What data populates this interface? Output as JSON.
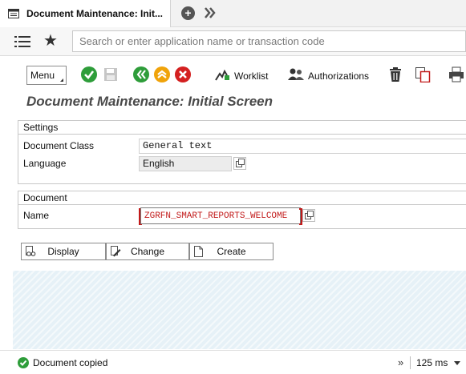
{
  "tab": {
    "title": "Document Maintenance: Init..."
  },
  "command": {
    "search_placeholder": "Search or enter application name or transaction code"
  },
  "toolbar": {
    "menu_label": "Menu",
    "worklist_label": "Worklist",
    "authorizations_label": "Authorizations"
  },
  "screen": {
    "title": "Document Maintenance: Initial Screen"
  },
  "settings": {
    "title": "Settings",
    "document_class_label": "Document Class",
    "document_class_value": "General text",
    "language_label": "Language",
    "language_value": "English"
  },
  "document": {
    "title": "Document",
    "name_label": "Name",
    "name_value": "ZGRFN_SMART_REPORTS_WELCOME"
  },
  "actions": {
    "display_label": "Display",
    "change_label": "Change",
    "create_label": "Create"
  },
  "status": {
    "message": "Document copied",
    "more": "»",
    "response_time": "125 ms"
  },
  "colors": {
    "green": "#2e9d3a",
    "orange": "#f0a30a",
    "red": "#d42020",
    "field_red": "#c21b1b",
    "hatch_blue": "#e6f1f7"
  }
}
